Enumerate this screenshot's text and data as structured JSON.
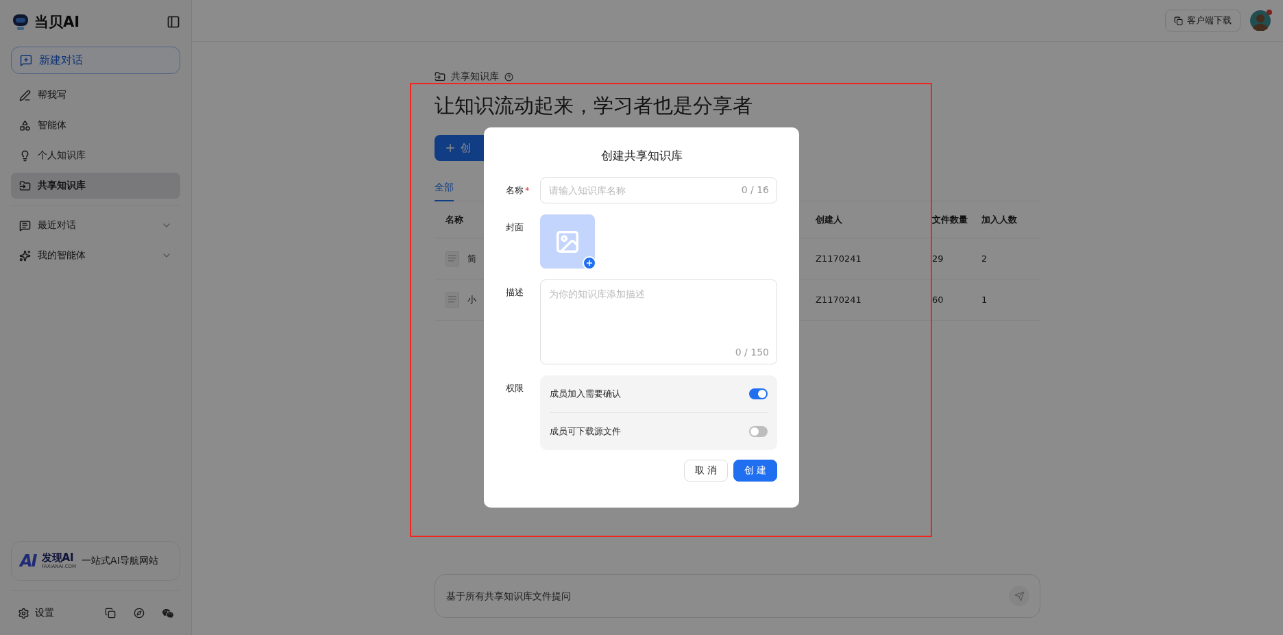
{
  "sidebar": {
    "brand": "当贝AI",
    "new_chat": "新建对话",
    "items": [
      {
        "label": "帮我写",
        "selected": false
      },
      {
        "label": "智能体",
        "selected": false
      },
      {
        "label": "个人知识库",
        "selected": false
      },
      {
        "label": "共享知识库",
        "selected": true
      }
    ],
    "groups": [
      {
        "label": "最近对话",
        "expanded": false
      },
      {
        "label": "我的智能体",
        "expanded": false
      }
    ],
    "banner": {
      "mark": "AI",
      "brand": "发现AI",
      "domain": "FAXIANAI.COM",
      "slogan": "一站式AI导航网站"
    },
    "settings": "设置"
  },
  "topbar": {
    "download": "客户端下载",
    "has_notification": true
  },
  "page": {
    "breadcrumb": "共享知识库",
    "heading": "让知识流动起来，学习者也是分享者",
    "create_button": "创",
    "tabs": [
      {
        "label": "全部",
        "selected": true
      }
    ],
    "table": {
      "columns": [
        "名称",
        "创建人",
        "文件数量",
        "加入人数"
      ],
      "rows": [
        {
          "name": "简",
          "creator": "Z1170241",
          "files": "29",
          "members": "2"
        },
        {
          "name": "小",
          "creator": "Z1170241",
          "files": "60",
          "members": "1"
        }
      ]
    }
  },
  "ask": {
    "placeholder": "基于所有共享知识库文件提问"
  },
  "dialog": {
    "title": "创建共享知识库",
    "name": {
      "label": "名称",
      "required_mark": "*",
      "placeholder": "请输入知识库名称",
      "count": "0 / 16"
    },
    "cover": {
      "label": "封面"
    },
    "description": {
      "label": "描述",
      "placeholder": "为你的知识库添加描述",
      "count": "0 / 150"
    },
    "permissions": {
      "label": "权限",
      "options": [
        {
          "label": "成员加入需要确认",
          "on": true
        },
        {
          "label": "成员可下载源文件",
          "on": false
        }
      ]
    },
    "buttons": [
      {
        "label": "取 消",
        "kind": "secondary"
      },
      {
        "label": "创 建",
        "kind": "primary"
      }
    ]
  }
}
